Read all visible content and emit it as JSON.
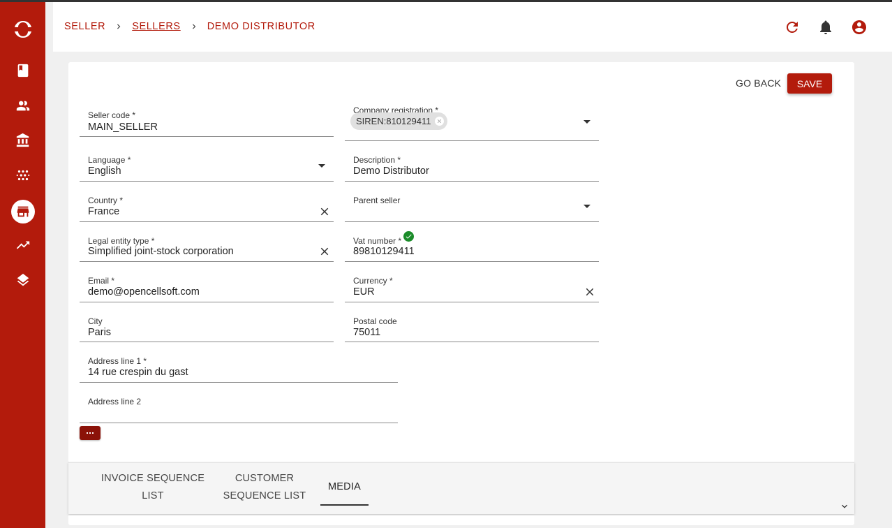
{
  "breadcrumb": {
    "root": "SELLER",
    "section": "SELLERS",
    "current": "DEMO DISTRIBUTOR"
  },
  "colors": {
    "brand": "#b31b0c",
    "valid": "#1b8c2a"
  },
  "header_icons": [
    "refresh-icon",
    "bell-icon",
    "account-icon"
  ],
  "sidebar_icons": [
    "book-icon",
    "customers-icon",
    "bank-icon",
    "grid-dots-icon",
    "store-icon",
    "trending-up-icon",
    "layers-icon"
  ],
  "actions": {
    "go_back": "GO BACK",
    "save": "SAVE"
  },
  "form": {
    "seller_code": {
      "label": "Seller code *",
      "value": "MAIN_SELLER"
    },
    "company_registration": {
      "label": "Company registration *",
      "chip": "SIREN:810129411"
    },
    "language": {
      "label": "Language *",
      "value": "English"
    },
    "description": {
      "label": "Description *",
      "value": "Demo Distributor"
    },
    "country": {
      "label": "Country *",
      "value": "France"
    },
    "parent_seller": {
      "label": "Parent seller",
      "value": ""
    },
    "legal_entity_type": {
      "label": "Legal entity type *",
      "value": "Simplified joint-stock corporation"
    },
    "vat_number": {
      "label": "Vat number *",
      "value": "89810129411"
    },
    "email": {
      "label": "Email *",
      "value": "demo@opencellsoft.com"
    },
    "currency": {
      "label": "Currency *",
      "value": "EUR"
    },
    "city": {
      "label": "City",
      "value": "Paris"
    },
    "postal_code": {
      "label": "Postal code",
      "value": "75011"
    },
    "address_line_1": {
      "label": "Address line 1 *",
      "value": "14 rue crespin du gast"
    },
    "address_line_2": {
      "label": "Address line 2",
      "value": ""
    }
  },
  "tabs": [
    {
      "line1": "INVOICE SEQUENCE",
      "line2": "LIST"
    },
    {
      "line1": "CUSTOMER",
      "line2": "SEQUENCE LIST"
    },
    {
      "line1": "MEDIA",
      "line2": ""
    }
  ]
}
